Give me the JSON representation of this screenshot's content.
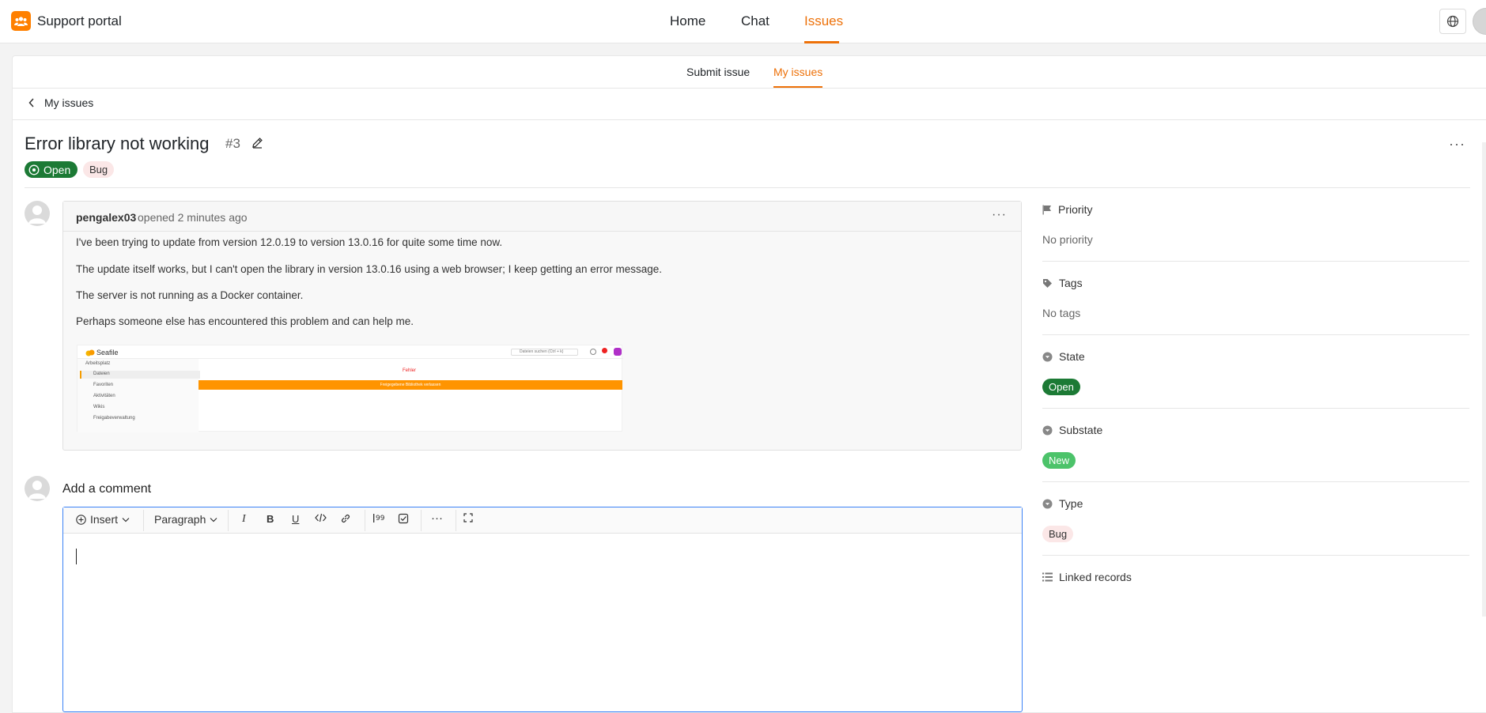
{
  "app": {
    "title": "Support portal",
    "brand_color": "#ff8000",
    "accent_color": "#ed7109"
  },
  "topnav": {
    "items": [
      "Home",
      "Chat",
      "Issues"
    ],
    "active": "Issues"
  },
  "subnav": {
    "items": [
      "Submit issue",
      "My issues"
    ],
    "active": "My issues"
  },
  "breadcrumb": {
    "back_label": "My issues"
  },
  "issue": {
    "title": "Error library not working",
    "number": "#3",
    "status": "Open",
    "label": "Bug"
  },
  "comment": {
    "author": "pengalex03",
    "meta": "opened 2 minutes ago",
    "paragraphs": [
      "I've been trying to update from version 12.0.19 to version 13.0.16 for quite some time now.",
      "The update itself works, but I can't open the library in version 13.0.16 using a web browser; I keep getting an error message.",
      "The server is not running as a Docker container.",
      "Perhaps someone else has encountered this problem and can help me."
    ],
    "attachment": {
      "app_name": "Seafile",
      "search_placeholder": "Dateien suchen (Ctrl + k)",
      "workspace_label": "Arbeitsplatz",
      "menu": [
        "Dateien",
        "Favoriten",
        "Aktivitäten",
        "Wikis",
        "Freigabeverwaltung"
      ],
      "error_text": "Fehler",
      "banner_text": "Freigegebene Bibliothek verlassen"
    }
  },
  "add_comment": {
    "label": "Add a comment",
    "toolbar": {
      "insert": "Insert",
      "paragraph": "Paragraph"
    }
  },
  "sidebar": {
    "priority": {
      "label": "Priority",
      "value": "No priority"
    },
    "tags": {
      "label": "Tags",
      "value": "No tags"
    },
    "state": {
      "label": "State",
      "value": "Open",
      "color": "#1c7a35"
    },
    "substate": {
      "label": "Substate",
      "value": "New",
      "color": "#4cc36a"
    },
    "type": {
      "label": "Type",
      "value": "Bug",
      "color": "#fbe7e7"
    },
    "linked": {
      "label": "Linked records"
    }
  }
}
